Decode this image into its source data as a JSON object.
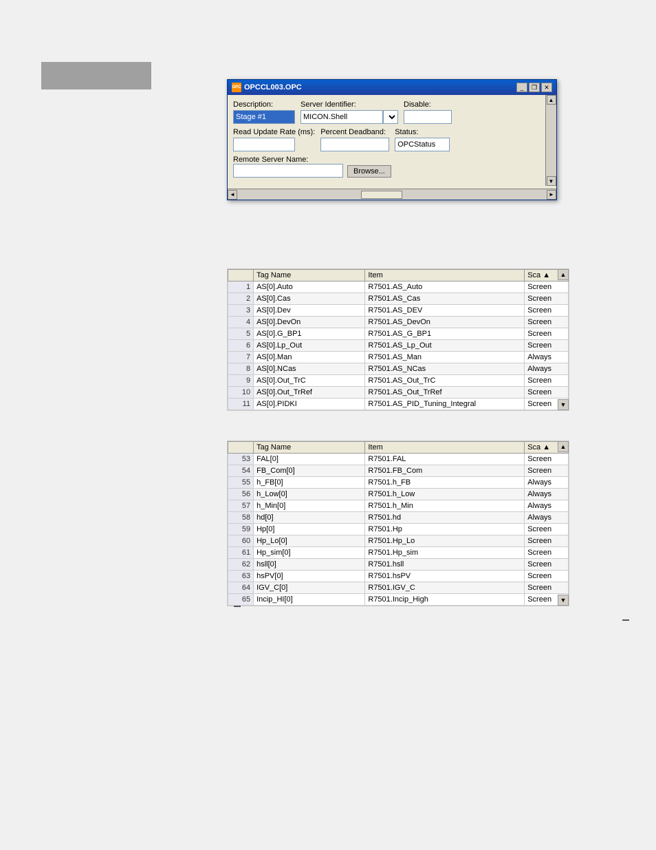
{
  "page": {
    "background_color": "#f0f0f0"
  },
  "dialog": {
    "title": "OPCCL003.OPC",
    "title_icon": "OPC",
    "description_label": "Description:",
    "description_value": "Stage #1",
    "server_identifier_label": "Server Identifier:",
    "server_identifier_value": "MICON.Shell",
    "disable_label": "Disable:",
    "disable_value": "",
    "read_update_label": "Read Update Rate (ms):",
    "read_update_value": "",
    "percent_deadband_label": "Percent Deadband:",
    "percent_deadband_value": "",
    "status_label": "Status:",
    "status_value": "OPCStatus",
    "remote_server_label": "Remote Server Name:",
    "remote_server_value": "",
    "browse_button": "Browse...",
    "title_btn_minimize": "_",
    "title_btn_restore": "❐",
    "title_btn_close": "✕"
  },
  "table1": {
    "columns": [
      "",
      "Tag Name",
      "Item",
      "Sca"
    ],
    "rows": [
      {
        "num": "1",
        "tag": "AS[0].Auto",
        "item": "R7501.AS_Auto",
        "sca": "Screen"
      },
      {
        "num": "2",
        "tag": "AS[0].Cas",
        "item": "R7501.AS_Cas",
        "sca": "Screen"
      },
      {
        "num": "3",
        "tag": "AS[0].Dev",
        "item": "R7501.AS_DEV",
        "sca": "Screen"
      },
      {
        "num": "4",
        "tag": "AS[0].DevOn",
        "item": "R7501.AS_DevOn",
        "sca": "Screen"
      },
      {
        "num": "5",
        "tag": "AS[0].G_BP1",
        "item": "R7501.AS_G_BP1",
        "sca": "Screen"
      },
      {
        "num": "6",
        "tag": "AS[0].Lp_Out",
        "item": "R7501.AS_Lp_Out",
        "sca": "Screen"
      },
      {
        "num": "7",
        "tag": "AS[0].Man",
        "item": "R7501.AS_Man",
        "sca": "Always"
      },
      {
        "num": "8",
        "tag": "AS[0].NCas",
        "item": "R7501.AS_NCas",
        "sca": "Always"
      },
      {
        "num": "9",
        "tag": "AS[0].Out_TrC",
        "item": "R7501.AS_Out_TrC",
        "sca": "Screen"
      },
      {
        "num": "10",
        "tag": "AS[0].Out_TrRef",
        "item": "R7501.AS_Out_TrRef",
        "sca": "Screen"
      },
      {
        "num": "11",
        "tag": "AS[0].PIDKI",
        "item": "R7501.AS_PID_Tuning_Integral",
        "sca": "Screen"
      }
    ]
  },
  "table2": {
    "columns": [
      "",
      "Tag Name",
      "Item",
      "Sca"
    ],
    "rows": [
      {
        "num": "53",
        "tag": "FAL[0]",
        "item": "R7501.FAL",
        "sca": "Screen"
      },
      {
        "num": "54",
        "tag": "FB_Com[0]",
        "item": "R7501.FB_Com",
        "sca": "Screen"
      },
      {
        "num": "55",
        "tag": "h_FB[0]",
        "item": "R7501.h_FB",
        "sca": "Always"
      },
      {
        "num": "56",
        "tag": "h_Low[0]",
        "item": "R7501.h_Low",
        "sca": "Always"
      },
      {
        "num": "57",
        "tag": "h_Min[0]",
        "item": "R7501.h_Min",
        "sca": "Always"
      },
      {
        "num": "58",
        "tag": "hd[0]",
        "item": "R7501.hd",
        "sca": "Always"
      },
      {
        "num": "59",
        "tag": "Hp[0]",
        "item": "R7501.Hp",
        "sca": "Screen"
      },
      {
        "num": "60",
        "tag": "Hp_Lo[0]",
        "item": "R7501.Hp_Lo",
        "sca": "Screen"
      },
      {
        "num": "61",
        "tag": "Hp_sim[0]",
        "item": "R7501.Hp_sim",
        "sca": "Screen"
      },
      {
        "num": "62",
        "tag": "hsll[0]",
        "item": "R7501.hsll",
        "sca": "Screen"
      },
      {
        "num": "63",
        "tag": "hsPV[0]",
        "item": "R7501.hsPV",
        "sca": "Screen"
      },
      {
        "num": "64",
        "tag": "IGV_C[0]",
        "item": "R7501.IGV_C",
        "sca": "Screen"
      },
      {
        "num": "65",
        "tag": "Incip_HI[0]",
        "item": "R7501.Incip_High",
        "sca": "Screen"
      }
    ]
  }
}
